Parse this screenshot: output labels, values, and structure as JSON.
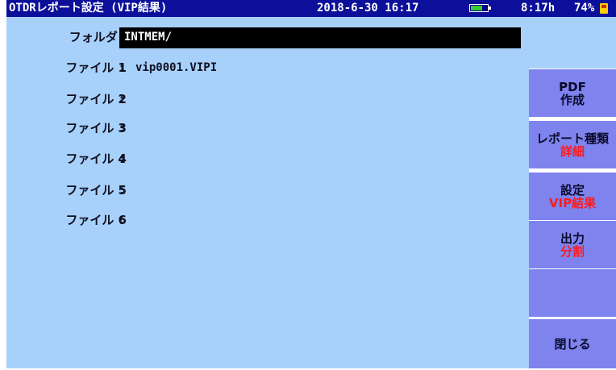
{
  "titlebar": {
    "title": "OTDRレポート設定 (VIP結果)",
    "datetime": "2018-6-30 16:17",
    "time_remaining": "8:17h",
    "battery_percent": "74%",
    "battery_level": 0.7,
    "battery_color": "#33cc33"
  },
  "form": {
    "folder": {
      "label": "フォルダ",
      "colon": ":",
      "value": "INTMEM/"
    },
    "files": [
      {
        "label": "ファイル 1",
        "colon": ":",
        "value": "vip0001.VIPI"
      },
      {
        "label": "ファイル 2",
        "colon": ":",
        "value": ""
      },
      {
        "label": "ファイル 3",
        "colon": ":",
        "value": ""
      },
      {
        "label": "ファイル 4",
        "colon": ":",
        "value": ""
      },
      {
        "label": "ファイル 5",
        "colon": ":",
        "value": ""
      },
      {
        "label": "ファイル 6",
        "colon": ":",
        "value": ""
      }
    ]
  },
  "buttons": [
    {
      "line1": "PDF",
      "line1b": "作成",
      "line2": ""
    },
    {
      "line1": "レポート種類",
      "line1b": "",
      "line2": "詳細"
    },
    {
      "line1": "設定",
      "line1b": "",
      "line2": "VIP結果"
    },
    {
      "line1": "出力",
      "line1b": "",
      "line2": "分割"
    },
    {
      "line1": "",
      "line1b": "",
      "line2": ""
    },
    {
      "line1": "閉じる",
      "line1b": "",
      "line2": ""
    }
  ],
  "colors": {
    "titlebar_bg": "#0b0f9a",
    "panel_bg": "#a7d0fb",
    "button_bg": "#7e83ee",
    "highlight_text": "#ff1a1a"
  }
}
